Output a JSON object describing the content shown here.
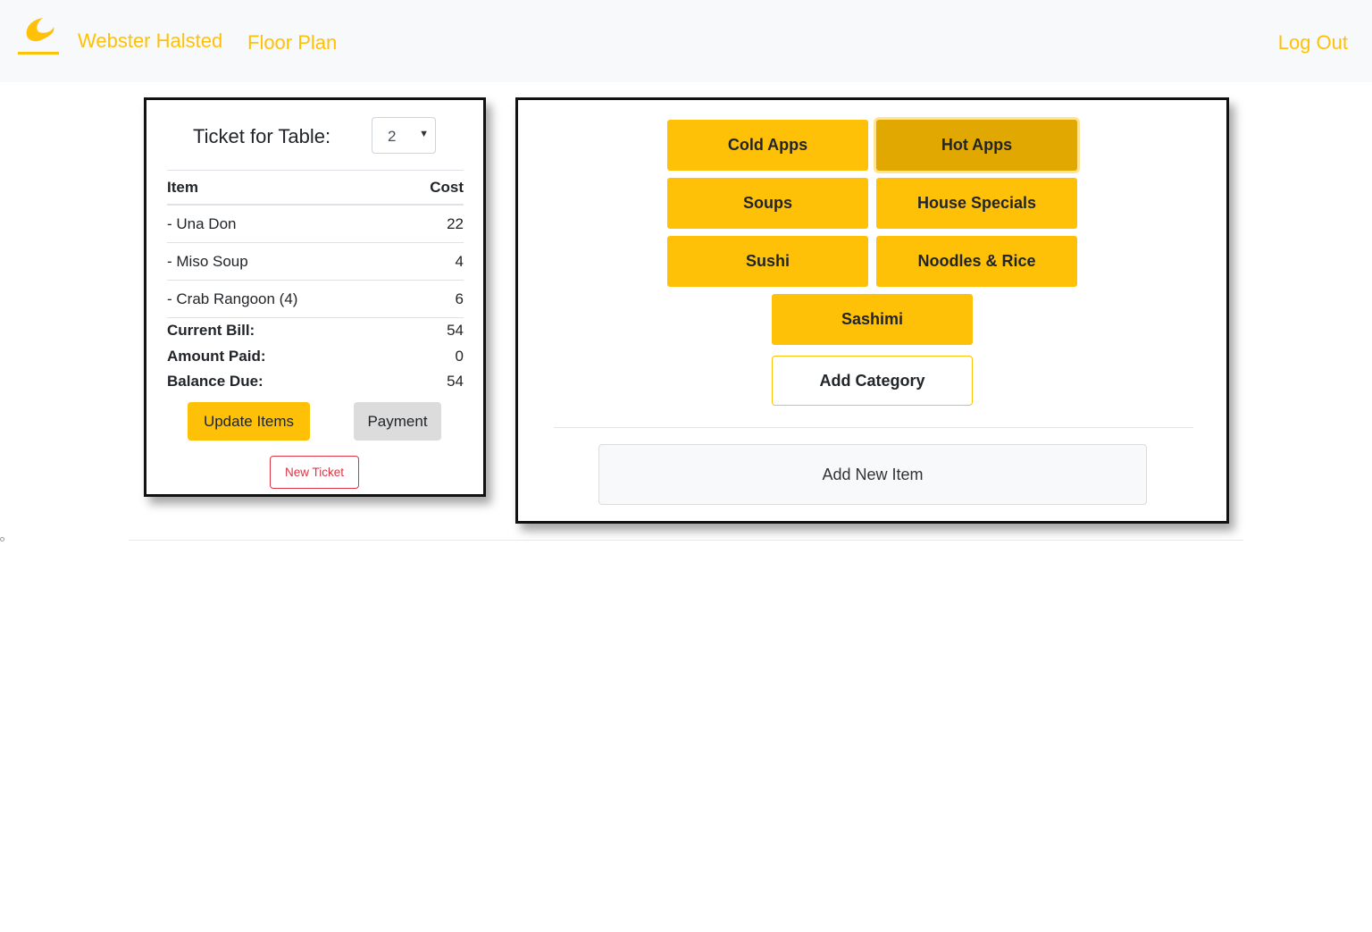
{
  "navbar": {
    "logo_icon": "flame-logo-icon",
    "brand": "Webster Halsted",
    "floor_plan": "Floor Plan",
    "logout": "Log Out",
    "accent_color": "#ffc107"
  },
  "ticket": {
    "title": "Ticket for Table:",
    "table_select": {
      "value": "2"
    },
    "columns": [
      "Item",
      "Cost"
    ],
    "items": [
      {
        "name": "- Una Don",
        "cost": "22"
      },
      {
        "name": "- Miso Soup",
        "cost": "4"
      },
      {
        "name": "- Crab Rangoon (4)",
        "cost": "6"
      }
    ],
    "summary": [
      {
        "label": "Current Bill:",
        "value": "54"
      },
      {
        "label": "Amount Paid:",
        "value": "0"
      },
      {
        "label": "Balance Due:",
        "value": "54"
      }
    ],
    "update_label": "Update Items",
    "payment_label": "Payment",
    "new_ticket_label": "New Ticket"
  },
  "menu": {
    "categories": [
      {
        "label": "Cold Apps",
        "active": false
      },
      {
        "label": "Hot Apps",
        "active": true
      },
      {
        "label": "Soups",
        "active": false
      },
      {
        "label": "House Specials",
        "active": false
      },
      {
        "label": "Sushi",
        "active": false
      },
      {
        "label": "Noodles & Rice",
        "active": false
      },
      {
        "label": "Sashimi",
        "active": false
      }
    ],
    "add_category_label": "Add Category",
    "add_item_label": "Add New Item"
  }
}
